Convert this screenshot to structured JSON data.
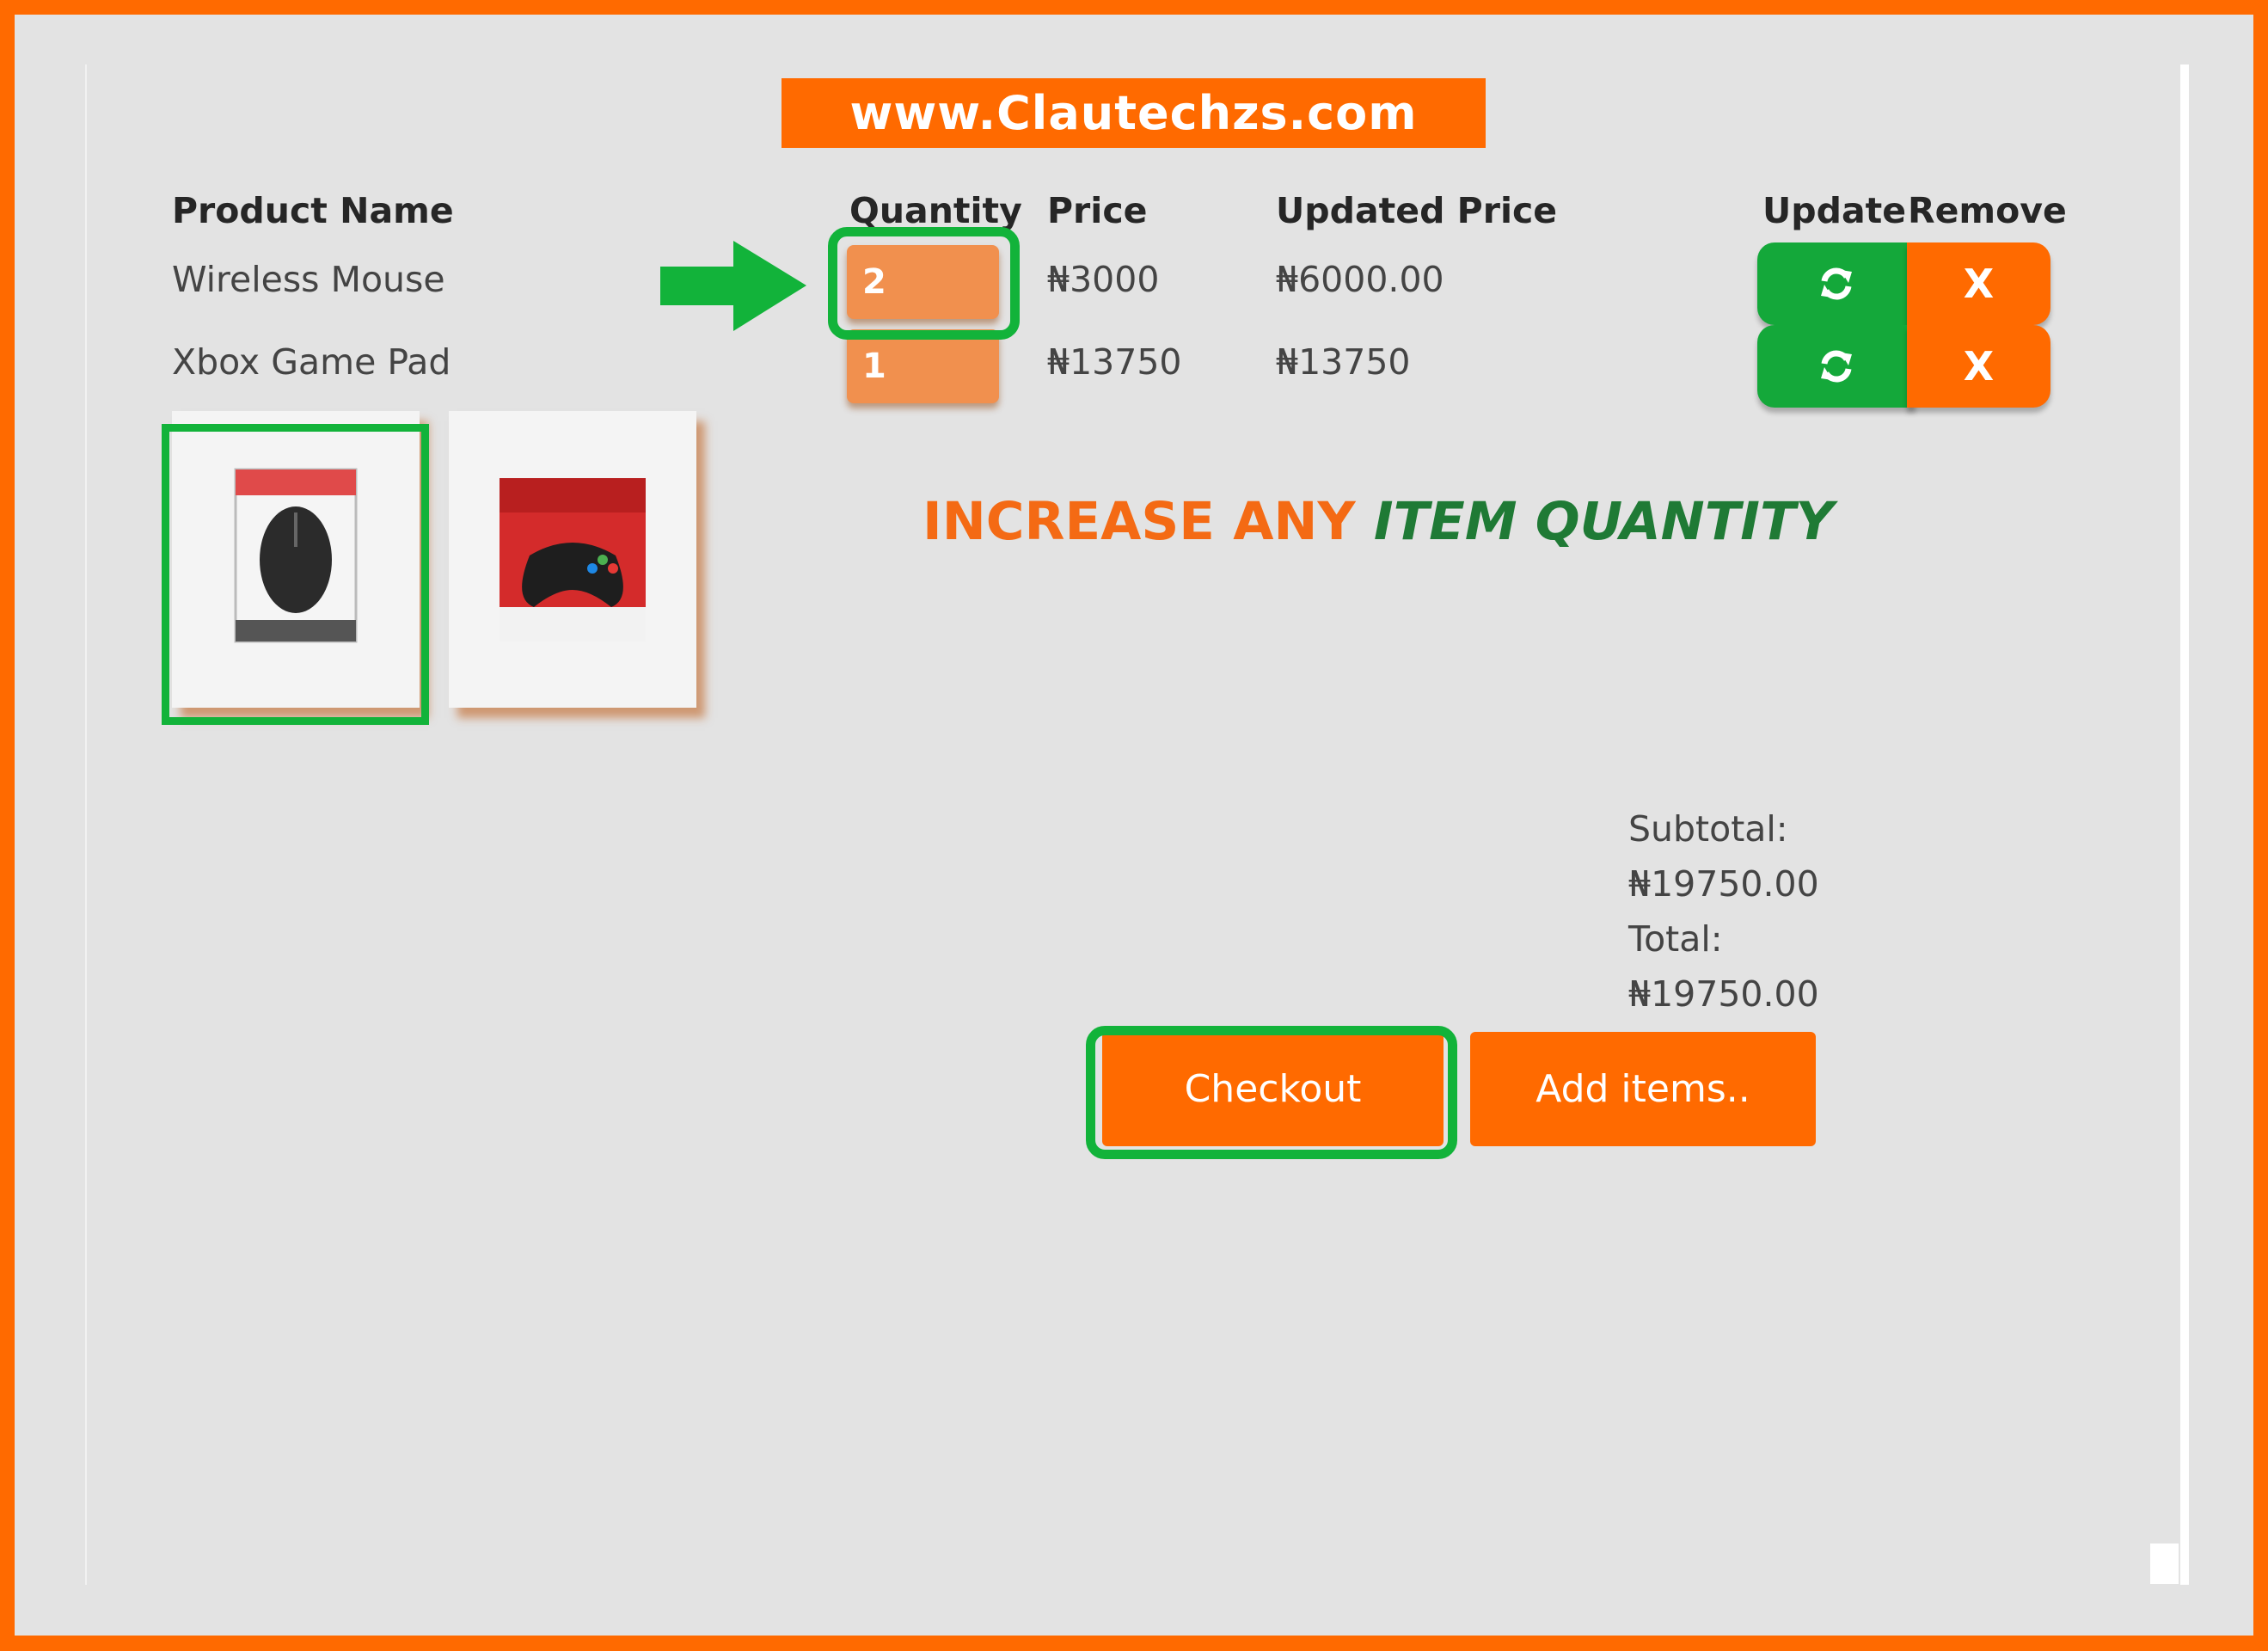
{
  "site": {
    "banner": "www.Clautechzs.com"
  },
  "table": {
    "headers": {
      "product_name": "Product Name",
      "quantity": "Quantity",
      "price": "Price",
      "updated_price": "Updated Price",
      "update": "Update",
      "remove": "Remove"
    },
    "rows": [
      {
        "name": "Wireless Mouse",
        "quantity": "2",
        "price": "₦3000",
        "updated_price": "₦6000.00",
        "remove_label": "X"
      },
      {
        "name": "Xbox Game Pad",
        "quantity": "1",
        "price": "₦13750",
        "updated_price": "₦13750",
        "remove_label": "X"
      }
    ]
  },
  "promo": {
    "part1": "INCREASE ANY ",
    "part2": "ITEM QUANTITY"
  },
  "totals": {
    "subtotal_label": "Subtotal:",
    "subtotal_value": "₦19750.00",
    "total_label": "Total:",
    "total_value": "₦19750.00"
  },
  "actions": {
    "checkout": "Checkout",
    "add_items": "Add items.."
  },
  "colors": {
    "brand_orange": "#ff6a00",
    "highlight_green": "#12b33a",
    "promo_green": "#1f7a35"
  },
  "icons": {
    "update": "refresh-icon",
    "arrow": "arrow-right-icon"
  }
}
